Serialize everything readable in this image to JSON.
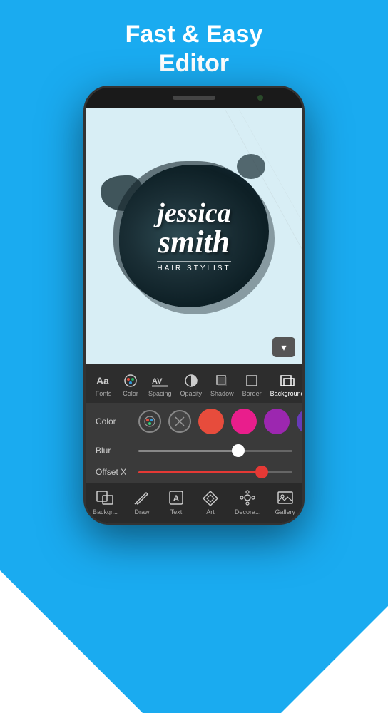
{
  "page": {
    "title_line1": "Fast & Easy",
    "title_line2": "Editor",
    "background_color": "#1aabf0"
  },
  "canvas": {
    "name_line1": "jessica",
    "name_line2": "smith",
    "subtitle": "HAIR STYLIST"
  },
  "toolbar": {
    "items": [
      {
        "id": "fonts",
        "label": "Fonts",
        "icon": "Aa"
      },
      {
        "id": "color",
        "label": "Color",
        "icon": "🎨"
      },
      {
        "id": "spacing",
        "label": "Spacing",
        "icon": "AV"
      },
      {
        "id": "opacity",
        "label": "Opacity",
        "icon": "◑"
      },
      {
        "id": "shadow",
        "label": "Shadow",
        "icon": "▢"
      },
      {
        "id": "border",
        "label": "Border",
        "icon": "▣"
      },
      {
        "id": "background",
        "label": "Background",
        "icon": "⬒"
      }
    ],
    "active": "background",
    "chevron_label": "▾"
  },
  "options": {
    "color_label": "Color",
    "blur_label": "Blur",
    "offset_x_label": "Offset X",
    "colors": [
      "#e74c3c",
      "#e91e8c",
      "#9c27b0"
    ],
    "blur_value": 65,
    "offset_x_value": 80
  },
  "bottom_nav": {
    "items": [
      {
        "id": "background",
        "label": "Backgr...",
        "icon": "background"
      },
      {
        "id": "draw",
        "label": "Draw",
        "icon": "draw"
      },
      {
        "id": "text",
        "label": "Text",
        "icon": "text"
      },
      {
        "id": "art",
        "label": "Art",
        "icon": "art"
      },
      {
        "id": "decora",
        "label": "Decora...",
        "icon": "decora"
      },
      {
        "id": "gallery",
        "label": "Gallery",
        "icon": "gallery"
      }
    ]
  }
}
